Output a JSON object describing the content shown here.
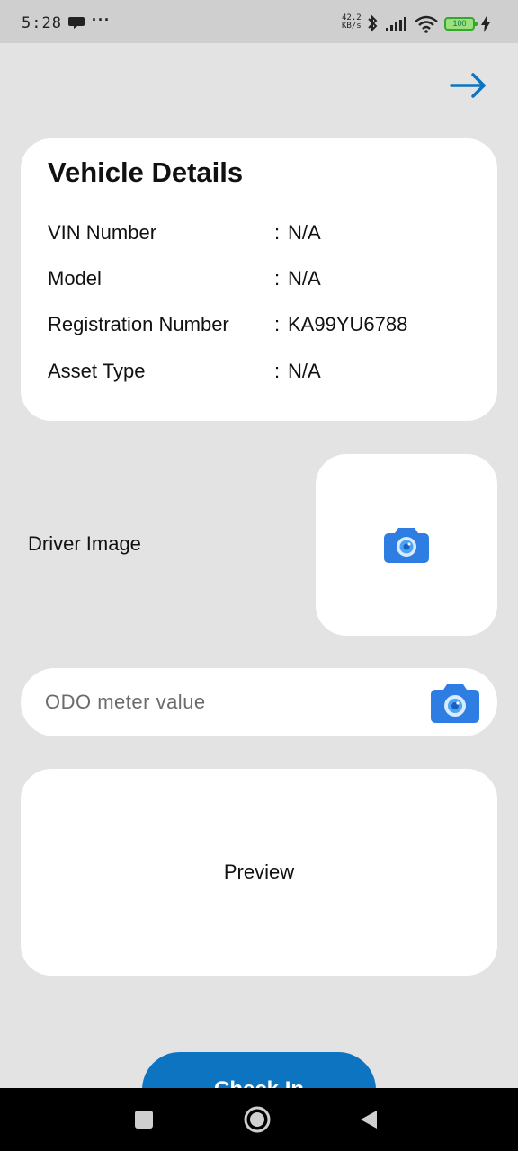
{
  "status_bar": {
    "time": "5:28",
    "dots": "···",
    "net_speed_value": "42.2",
    "net_speed_unit": "KB/s",
    "battery": "100"
  },
  "header": {
    "next_icon": "arrow-right-icon",
    "accent_color": "#0d74c1"
  },
  "vehicle_details": {
    "title": "Vehicle Details",
    "rows": [
      {
        "label": "VIN Number",
        "colon": ":",
        "value": "N/A"
      },
      {
        "label": "Model",
        "colon": ":",
        "value": "N/A"
      },
      {
        "label": "Registration Number",
        "colon": ":",
        "value": "KA99YU6788"
      },
      {
        "label": "Asset Type",
        "colon": ":",
        "value": "N/A"
      }
    ]
  },
  "driver_image": {
    "label": "Driver Image",
    "icon": "camera-icon"
  },
  "odo": {
    "placeholder": "ODO meter value",
    "value": "",
    "icon": "camera-icon"
  },
  "preview": {
    "label": "Preview"
  },
  "actions": {
    "check_in_label": "Check In"
  },
  "nav": {
    "recents_icon": "square-icon",
    "home_icon": "circle-icon",
    "back_icon": "triangle-back-icon"
  }
}
